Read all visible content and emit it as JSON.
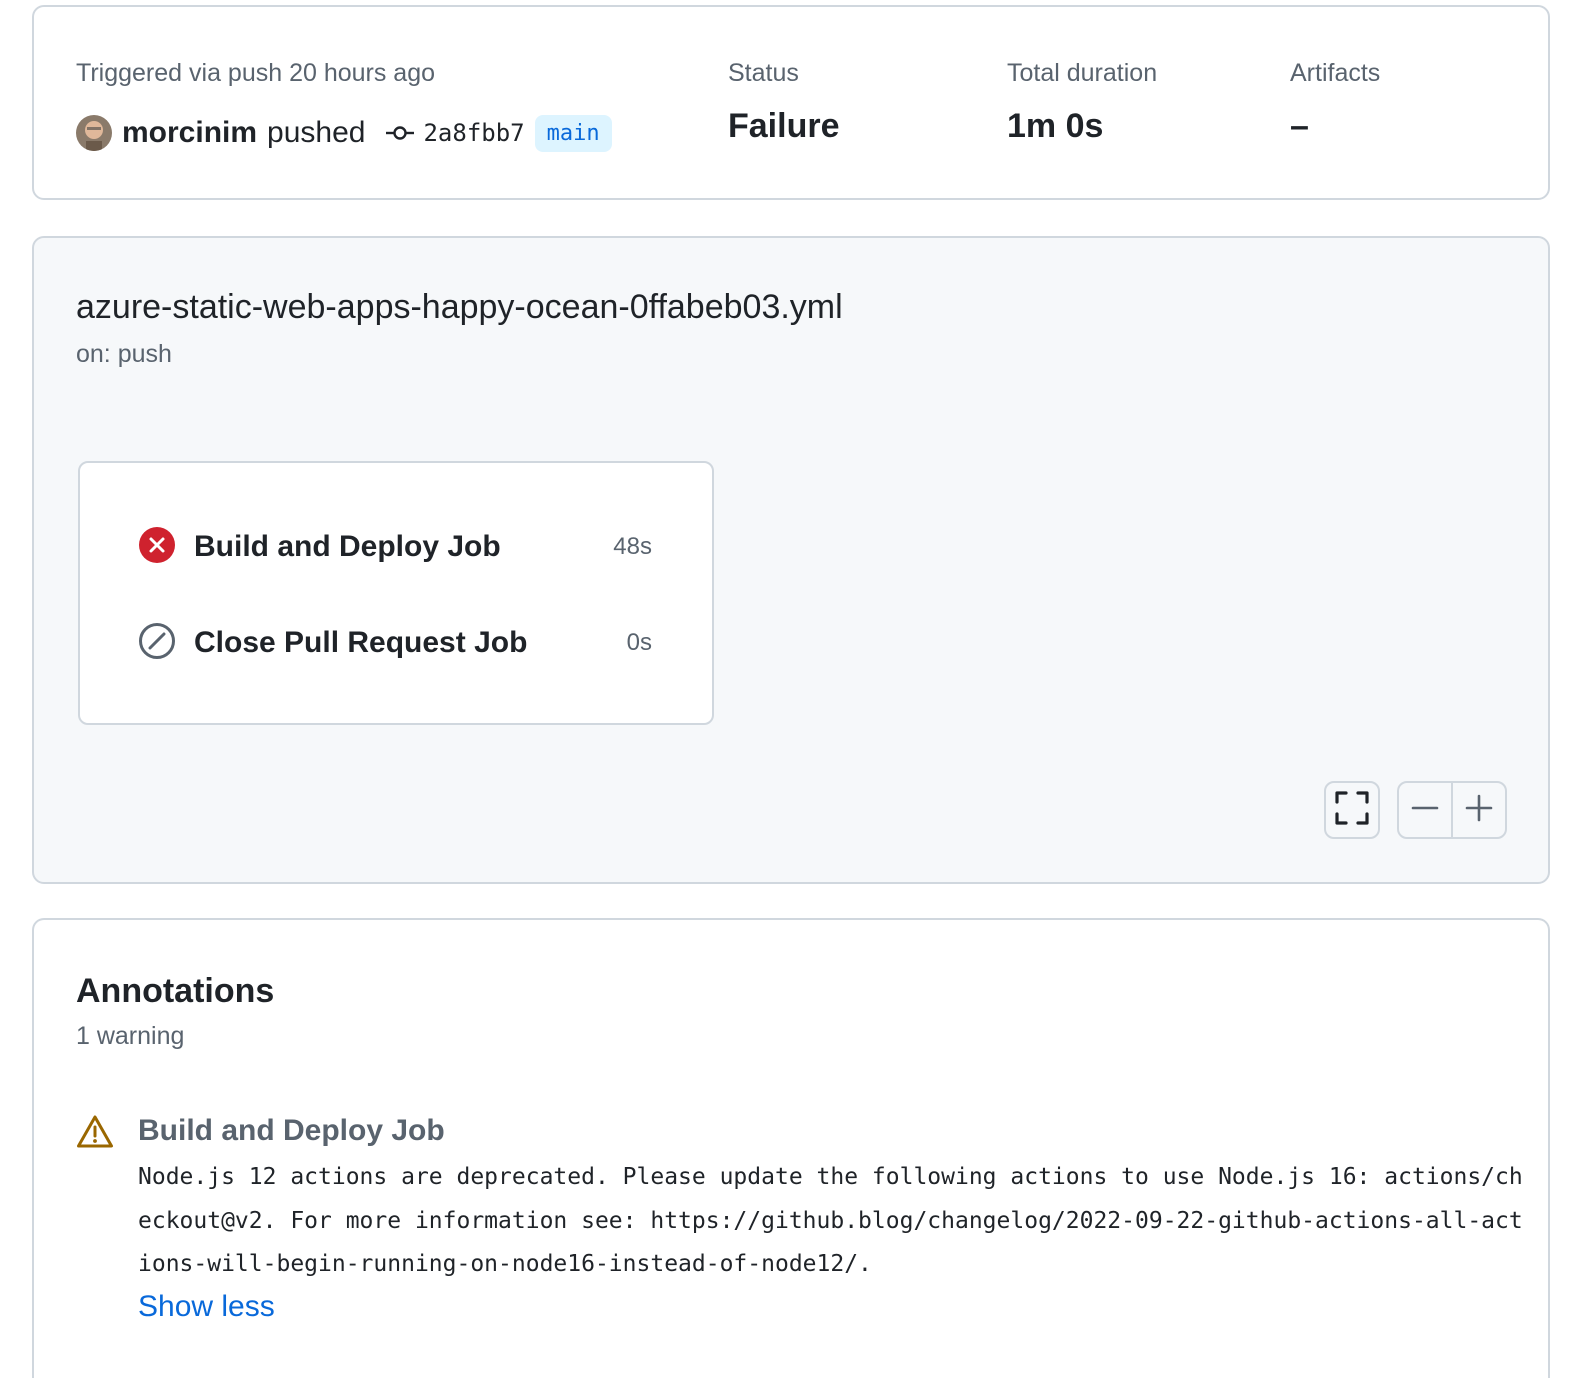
{
  "summary": {
    "triggered": "Triggered via push 20 hours ago",
    "actor": "morcinim",
    "action": "pushed",
    "commit_sha": "2a8fbb7",
    "branch": "main",
    "status_label": "Status",
    "status_value": "Failure",
    "duration_label": "Total duration",
    "duration_value": "1m 0s",
    "artifacts_label": "Artifacts",
    "artifacts_value": "–"
  },
  "workflow": {
    "filename": "azure-static-web-apps-happy-ocean-0ffabeb03.yml",
    "trigger": "on: push",
    "jobs": [
      {
        "name": "Build and Deploy Job",
        "duration": "48s",
        "status": "failure",
        "icon": "x-circle-fill-icon"
      },
      {
        "name": "Close Pull Request Job",
        "duration": "0s",
        "status": "skipped",
        "icon": "skip-icon"
      }
    ],
    "controls": {
      "fullscreen_icon": "fullscreen-icon",
      "zoom_out_icon": "zoom-out-icon",
      "zoom_in_icon": "zoom-in-icon"
    }
  },
  "annotations": {
    "title": "Annotations",
    "count": "1 warning",
    "items": [
      {
        "icon": "alert-icon",
        "job": "Build and Deploy Job",
        "message": "Node.js 12 actions are deprecated. Please update the following actions to use Node.js 16: actions/checkout@v2. For more information see: https://github.blog/changelog/2022-09-22-github-actions-all-actions-will-begin-running-on-node16-instead-of-node12/.",
        "toggle": "Show less"
      }
    ]
  },
  "colors": {
    "failure": "#cf222e",
    "warning": "#9a6700",
    "link": "#0969da",
    "branch_bg": "#ddf4ff"
  }
}
